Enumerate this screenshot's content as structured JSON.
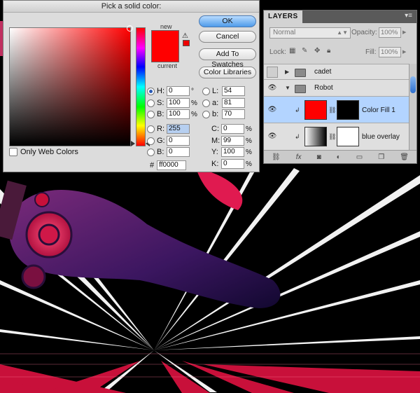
{
  "colors": {
    "selected": "#ff0000",
    "accent": "#3a7bd5",
    "selected_row": "#b3d4ff"
  },
  "picker": {
    "title": "Pick a solid color:",
    "new_label": "new",
    "current_label": "current",
    "buttons": {
      "ok": "OK",
      "cancel": "Cancel",
      "add_to_swatches": "Add To Swatches",
      "color_libraries": "Color Libraries"
    },
    "web_only_label": "Only Web Colors",
    "fields": {
      "H": {
        "label": "H:",
        "value": "0",
        "unit": "°"
      },
      "S": {
        "label": "S:",
        "value": "100",
        "unit": "%"
      },
      "B": {
        "label": "B:",
        "value": "100",
        "unit": "%"
      },
      "R": {
        "label": "R:",
        "value": "255"
      },
      "G": {
        "label": "G:",
        "value": "0"
      },
      "Bv": {
        "label": "B:",
        "value": "0"
      },
      "L": {
        "label": "L:",
        "value": "54"
      },
      "a": {
        "label": "a:",
        "value": "81"
      },
      "b": {
        "label": "b:",
        "value": "70"
      },
      "C": {
        "label": "C:",
        "value": "0",
        "unit": "%"
      },
      "M": {
        "label": "M:",
        "value": "99",
        "unit": "%"
      },
      "Y": {
        "label": "Y:",
        "value": "100",
        "unit": "%"
      },
      "K": {
        "label": "K:",
        "value": "0",
        "unit": "%"
      }
    },
    "hex_label": "#",
    "hex_value": "ff0000"
  },
  "layers": {
    "title": "LAYERS",
    "blend_mode": "Normal",
    "opacity_label": "Opacity:",
    "opacity_value": "100%",
    "lock_label": "Lock:",
    "fill_label": "Fill:",
    "fill_value": "100%",
    "rows": [
      {
        "name": "cadet",
        "type": "group",
        "expanded": false
      },
      {
        "name": "Robot",
        "type": "group",
        "expanded": true
      },
      {
        "name": "Color Fill 1",
        "type": "fill"
      },
      {
        "name": "blue overlay",
        "type": "gradient"
      }
    ],
    "footer_icons": [
      "link-icon",
      "fx-icon",
      "mask-icon",
      "adjustment-icon",
      "folder-icon",
      "new-layer-icon",
      "trash-icon"
    ]
  }
}
